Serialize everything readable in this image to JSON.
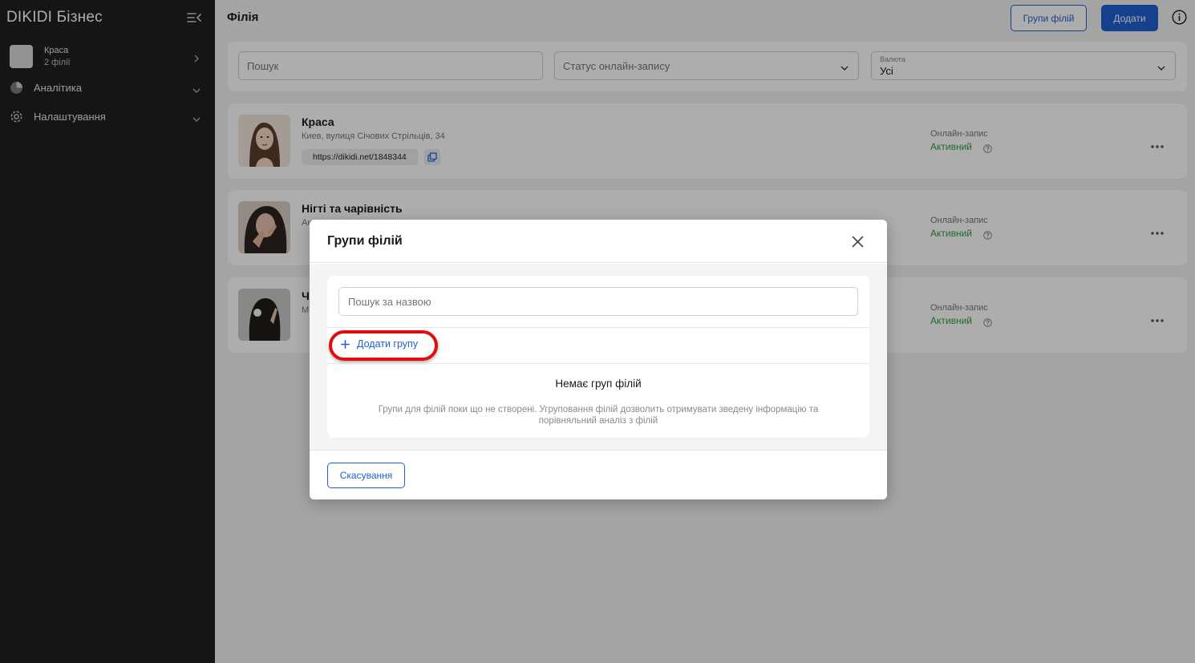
{
  "sidebar": {
    "brand": "DIKIDI Бізнес",
    "account": {
      "name": "Краса",
      "sub": "2 філії"
    },
    "items": [
      {
        "label": "Аналітика",
        "icon": "pie-chart-icon"
      },
      {
        "label": "Налаштування",
        "icon": "gear-icon"
      }
    ]
  },
  "header": {
    "title": "Філія",
    "groups_button": "Групи філій",
    "add_button": "Додати"
  },
  "filters": {
    "search_placeholder": "Пошук",
    "status_placeholder": "Статус онлайн-запису",
    "currency_label": "Валюта",
    "currency_value": "Усі"
  },
  "branches": [
    {
      "name": "Краса",
      "address": "Киев, вулиця Січових Стрільців, 34",
      "link": "https://dikidi.net/1848344",
      "status_label": "Онлайн-запис",
      "status_value": "Активний"
    },
    {
      "name": "Нігті та чарівність",
      "address": "Ак",
      "link": "",
      "status_label": "Онлайн-запис",
      "status_value": "Активний"
    },
    {
      "name": "Ч",
      "address": "М",
      "link": "",
      "status_label": "Онлайн-запис",
      "status_value": "Активний"
    }
  ],
  "modal": {
    "title": "Групи філій",
    "search_placeholder": "Пошук за назвою",
    "add_group": "Додати групу",
    "empty_title": "Немає груп філій",
    "empty_desc": "Групи для філій поки що не створені. Угруповання філій дозволить отримувати зведену інформацію та порівняльний аналіз з філій",
    "cancel": "Скасування"
  },
  "colors": {
    "accent": "#1f5fd1",
    "status_active": "#2e9c3e",
    "highlight": "#e00d0d"
  }
}
